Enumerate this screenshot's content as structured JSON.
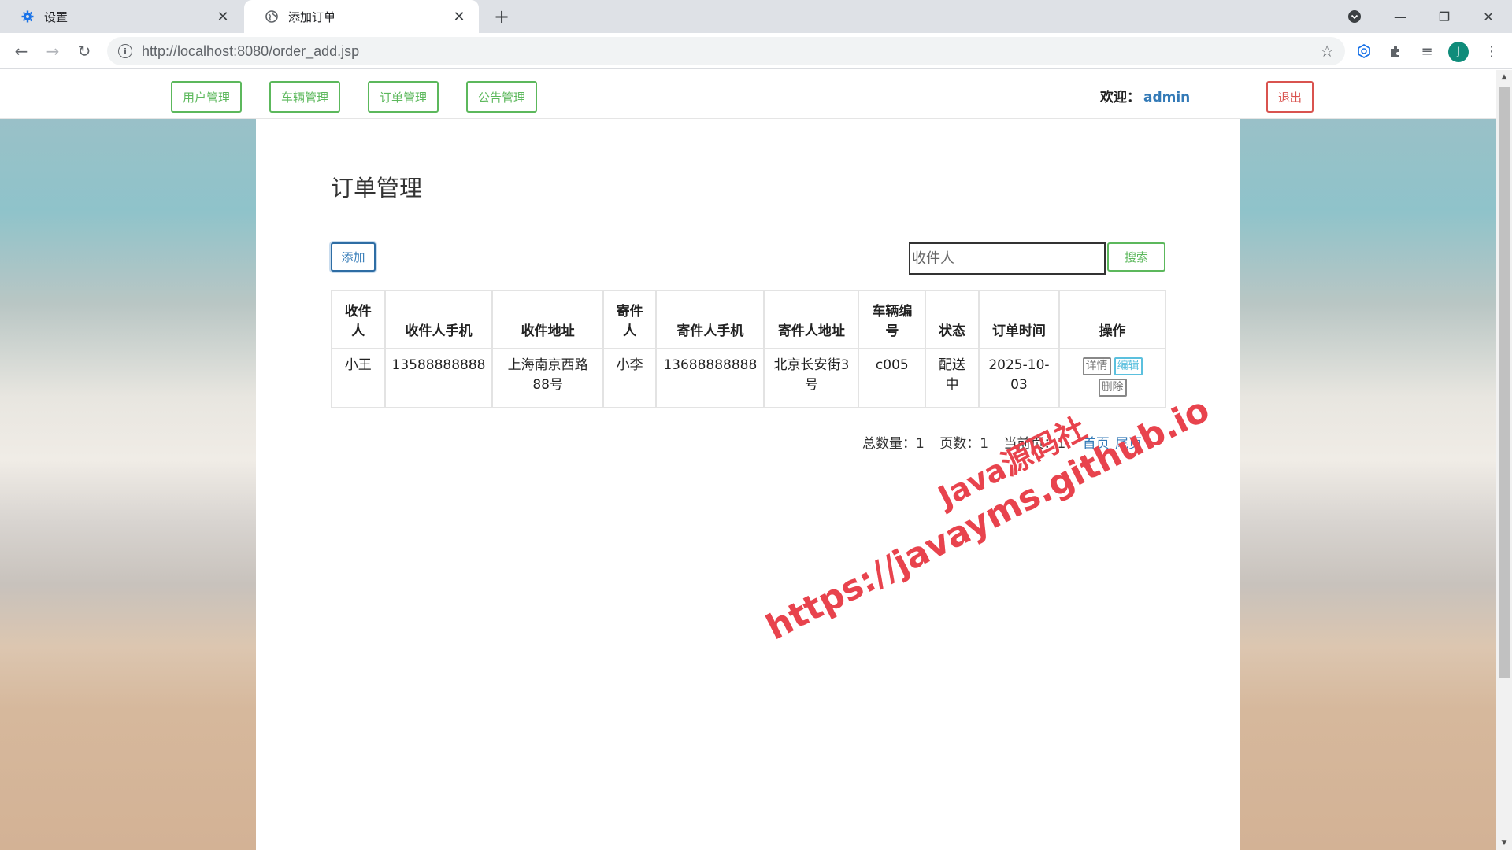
{
  "browser": {
    "tabs": [
      {
        "title": "设置",
        "icon": "gear-icon"
      },
      {
        "title": "添加订单",
        "icon": "globe-icon"
      }
    ],
    "url_host": "http://localhost:8080/order_add.jsp",
    "profile_initial": "J"
  },
  "nav": {
    "items": [
      "用户管理",
      "车辆管理",
      "订单管理",
      "公告管理"
    ],
    "welcome_label": "欢迎：",
    "username": "admin",
    "logout": "退出"
  },
  "main": {
    "title": "订单管理",
    "add_button": "添加",
    "search_placeholder": "收件人",
    "search_button": "搜索",
    "table": {
      "headers": [
        "收件人",
        "收件人手机",
        "收件地址",
        "寄件人",
        "寄件人手机",
        "寄件人地址",
        "车辆编号",
        "状态",
        "订单时间",
        "操作"
      ],
      "rows": [
        {
          "receiver": "小王",
          "receiver_phone": "13588888888",
          "receiver_address": "上海南京西路88号",
          "sender": "小李",
          "sender_phone": "13688888888",
          "sender_address": "北京长安街3号",
          "vehicle_no": "c005",
          "status": "配送中",
          "order_time": "2025-10-03",
          "actions": [
            "详情",
            "编辑",
            "删除"
          ]
        }
      ]
    },
    "pager": {
      "total": "总数量：1",
      "pages": "页数：1",
      "current": "当前页：1",
      "first": "首页",
      "last": "尾页"
    }
  },
  "watermark": {
    "line1": "Java源码社",
    "line2": "https://javayms.github.io"
  },
  "colors": {
    "success": "#5cb85c",
    "danger": "#d9534f",
    "primary": "#337ab7",
    "info": "#5bc0de",
    "watermark": "#e8434d"
  }
}
